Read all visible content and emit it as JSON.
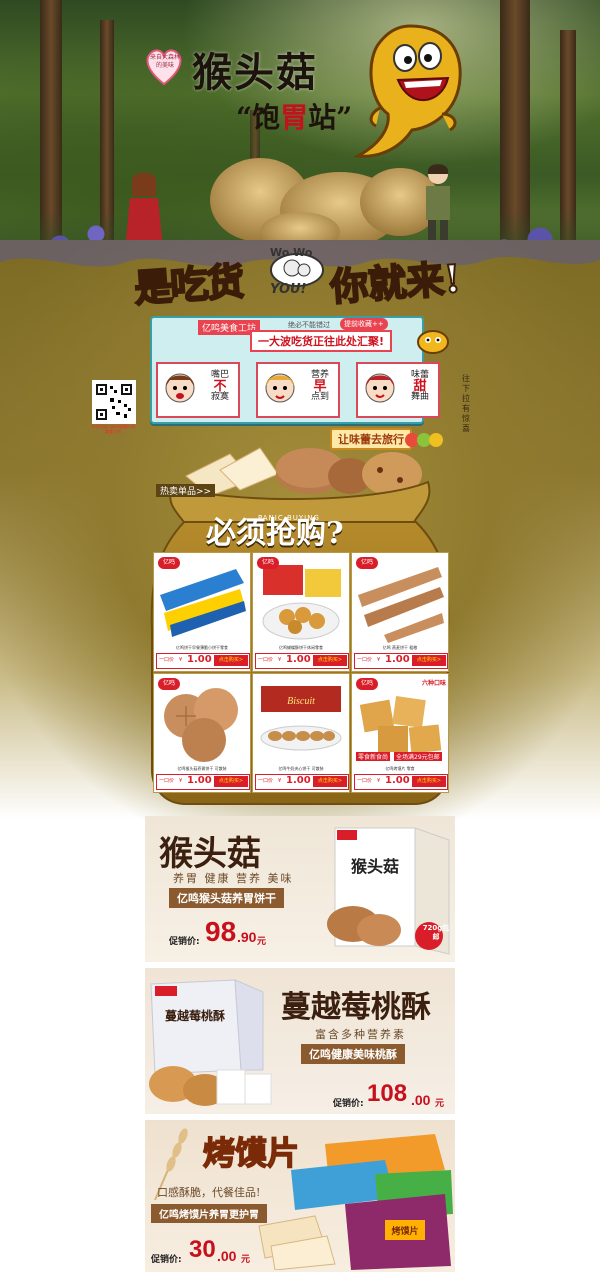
{
  "hero": {
    "heart_text": "来自大森林的美味",
    "title": "猴头菇",
    "sub_left": "“饱",
    "sub_red": "胃",
    "sub_right": "站”"
  },
  "slogan": {
    "left_a": "是",
    "left_b": "吃货",
    "right": "你就来!",
    "ww_top": "Wo Wo",
    "ww_bottom": "YOU!"
  },
  "promo": {
    "tag": "亿鸣美食工坊",
    "note": "绝必不能错过",
    "pill": "提前收藏++",
    "headline": "一大波吃货正往此处汇聚!",
    "cards": [
      {
        "l1": "嘴巴",
        "r": "不",
        "l2": "寂寞"
      },
      {
        "l1": "营养",
        "r": "早",
        "l2": "点到"
      },
      {
        "l1": "味蕾",
        "r": "甜",
        "l2": "舞曲"
      }
    ],
    "travel": "让味蕾去旅行",
    "scroll_hint": "往下拉有惊喜"
  },
  "qr": {
    "caption": "手机扫描二维码收藏亿鸣美食工坊"
  },
  "hot": {
    "label": "热卖单品>>",
    "panic_en": "PANIC BUYING",
    "panic_cn": "必须抢购?"
  },
  "products": [
    {
      "name": "亿鸣饼干早餐薄脆小饼干零食",
      "price_label": "一口价",
      "yen": "¥",
      "price": "1.00",
      "btn": "点击购买>"
    },
    {
      "name": "亿鸣蝴蝶酥饼干休闲零食",
      "price_label": "一口价",
      "yen": "¥",
      "price": "1.00",
      "btn": "点击购买>"
    },
    {
      "name": "亿鸣 燕麦饼干 粗粮",
      "price_label": "一口价",
      "yen": "¥",
      "price": "1.00",
      "btn": "点击购买>"
    },
    {
      "name": "亿鸣猴头菇养胃饼干 可散装",
      "price_label": "一口价",
      "yen": "¥",
      "price": "1.00",
      "btn": "点击购买>"
    },
    {
      "name": "亿鸣牛奶夹心饼干 可散装",
      "price_label": "一口价",
      "yen": "¥",
      "price": "1.00",
      "btn": "点击购买>"
    },
    {
      "name": "亿鸣烤馍片 零食",
      "price_label": "一口价",
      "yen": "¥",
      "price": "1.00",
      "btn": "点击购买>"
    }
  ],
  "product_badges": {
    "six": "六种口味",
    "deal_a": "零食新食尚",
    "deal_b": "全场满29元包邮"
  },
  "banners": [
    {
      "title": "猴头菇",
      "sub": "养胃 健康 营养 美味",
      "strip": "亿鸣猴头菇养胃饼干",
      "price_label": "促销价:",
      "price_int": "98",
      "price_dec": ".90",
      "unit": "元",
      "box_text": "猴头菇",
      "badge": "720g包邮"
    },
    {
      "title": "蔓越莓桃酥",
      "sub": "富含多种营养素",
      "strip": "亿鸣健康美味桃酥",
      "price_label": "促销价:",
      "price_int": "108",
      "price_dec": ".00",
      "unit": "元",
      "box_text": "蔓越莓桃酥"
    },
    {
      "title": "烤馍片",
      "sub": "口感酥脆，代餐佳品!",
      "strip": "亿鸣烤馍片养胃更护胃",
      "price_label": "促销价:",
      "price_int": "30",
      "price_dec": ".00",
      "unit": "元",
      "pack_text": "烤馍片"
    }
  ],
  "brand": "亿鸣"
}
